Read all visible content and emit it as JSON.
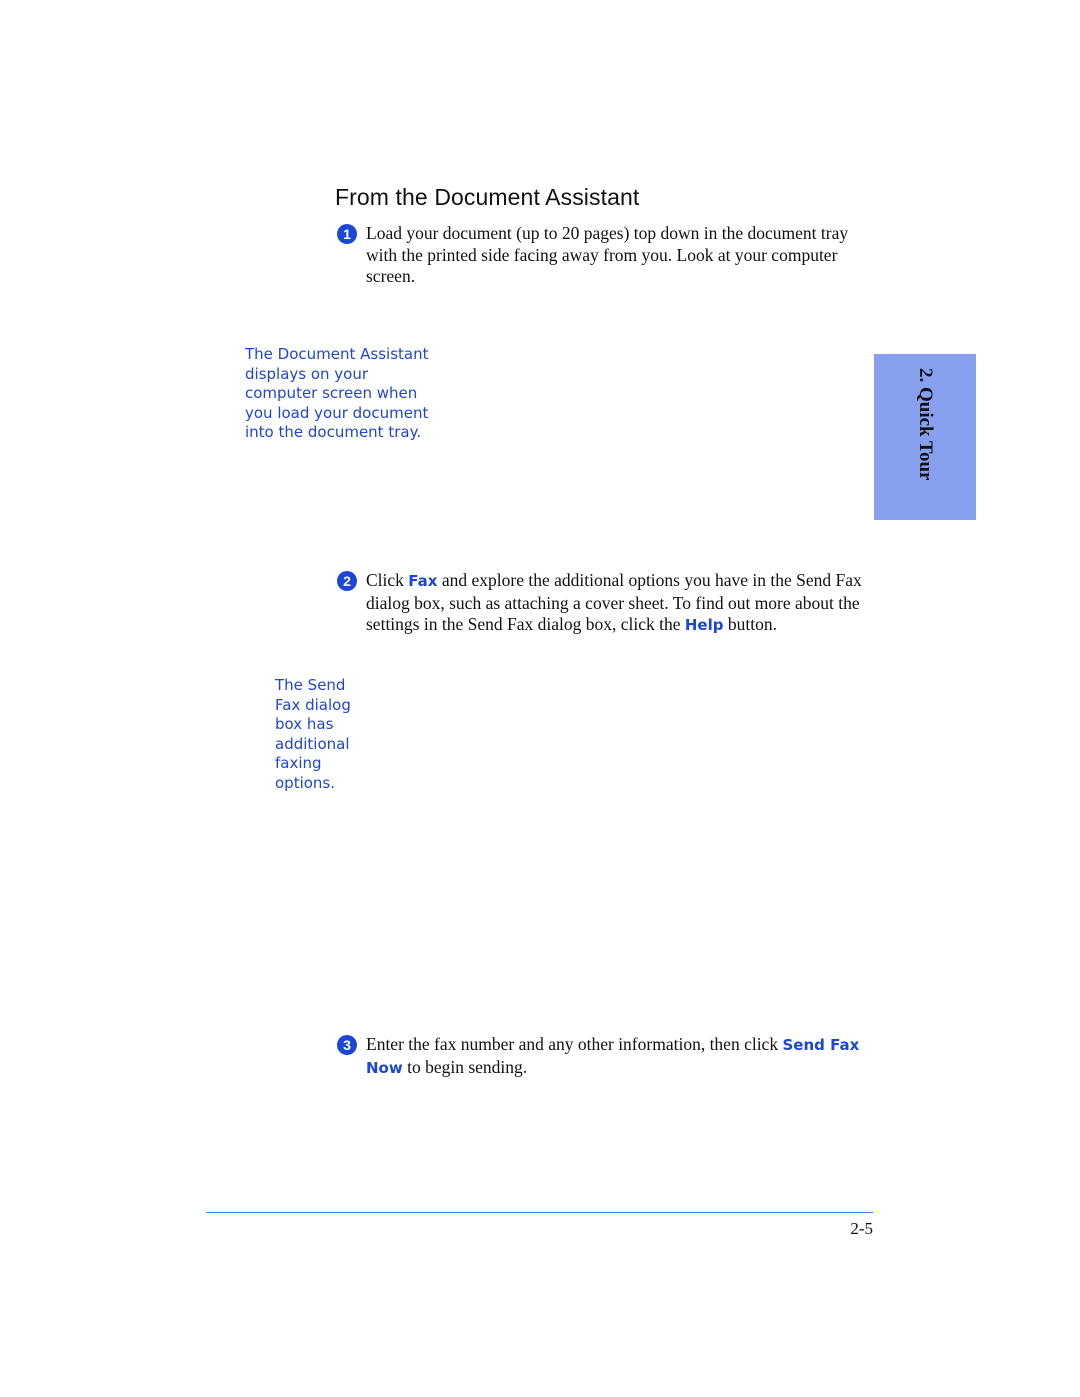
{
  "section_title": "From the Document Assistant",
  "tab": {
    "label": "2. Quick Tour",
    "color": "#87a0ee"
  },
  "steps": [
    {
      "number": "1",
      "text": "Load your document (up to 20 pages) top down in the document tray with the printed side facing away from you. Look at your computer screen."
    },
    {
      "number": "2",
      "parts": [
        "Click ",
        "Fax",
        " and explore the additional options you have in the Send Fax dialog box, such as attaching a cover sheet. To find out more about the settings in the Send Fax dialog box, click the ",
        "Help",
        " button."
      ]
    },
    {
      "number": "3",
      "parts": [
        "Enter the fax number and any other information, then click ",
        "Send Fax Now",
        " to begin sending."
      ]
    }
  ],
  "notes": [
    {
      "lines": [
        "The Document Assistant",
        "displays on your",
        "computer screen when",
        "you load your document",
        "into the document tray."
      ]
    },
    {
      "lines": [
        "The Send",
        "Fax dialog",
        "box has",
        "additional",
        "faxing",
        "options."
      ]
    }
  ],
  "footer": {
    "page_number": "2-5"
  },
  "colors": {
    "accent": "#1a47d6",
    "rule": "#3d7fe0"
  }
}
